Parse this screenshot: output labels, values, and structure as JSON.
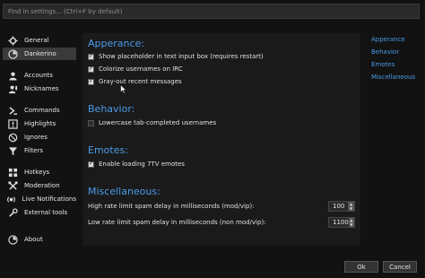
{
  "search": {
    "placeholder": "Find in settings... (Ctrl+F by default)",
    "value": ""
  },
  "sidebar": {
    "items": [
      {
        "label": "General",
        "icon": "gear-icon"
      },
      {
        "label": "Dankerino",
        "icon": "dankerino-icon",
        "active": true
      },
      {
        "label": "Accounts",
        "icon": "accounts-icon"
      },
      {
        "label": "Nicknames",
        "icon": "nicknames-icon"
      },
      {
        "label": "Commands",
        "icon": "commands-icon"
      },
      {
        "label": "Highlights",
        "icon": "highlights-icon"
      },
      {
        "label": "Ignores",
        "icon": "ignores-icon"
      },
      {
        "label": "Filters",
        "icon": "filter-icon"
      },
      {
        "label": "Hotkeys",
        "icon": "hotkeys-icon"
      },
      {
        "label": "Moderation",
        "icon": "moderation-icon"
      },
      {
        "label": "Live Notifications",
        "icon": "notifications-icon"
      },
      {
        "label": "External tools",
        "icon": "external-tools-icon"
      },
      {
        "label": "About",
        "icon": "about-icon"
      }
    ]
  },
  "sections": {
    "appearance": {
      "title": "Apperance:",
      "options": [
        {
          "label": "Show placeholder in text input box (requires restart)",
          "checked": true
        },
        {
          "label": "Colorize usernames on IRC",
          "checked": true
        },
        {
          "label": "Gray-out recent messages",
          "checked": true
        }
      ]
    },
    "behavior": {
      "title": "Behavior:",
      "options": [
        {
          "label": "Lowercase tab-completed usernames",
          "checked": false
        }
      ]
    },
    "emotes": {
      "title": "Emotes:",
      "options": [
        {
          "label": "Enable loading 7TV emotes",
          "checked": true
        }
      ]
    },
    "misc": {
      "title": "Miscellaneous:",
      "rows": [
        {
          "label": "High rate limit spam delay in milliseconds (mod/vip):",
          "value": "100"
        },
        {
          "label": "Low rate limit spam delay in milliseconds (non mod/vip):",
          "value": "1100"
        }
      ]
    }
  },
  "toc": [
    "Apperance",
    "Behavior",
    "Emotes",
    "Miscellaneous"
  ],
  "buttons": {
    "ok": "Ok",
    "cancel": "Cancel"
  },
  "colors": {
    "accent": "#4b9be8",
    "background": "#121212",
    "panel": "#1a1a1a",
    "active": "#3a3a3a"
  }
}
